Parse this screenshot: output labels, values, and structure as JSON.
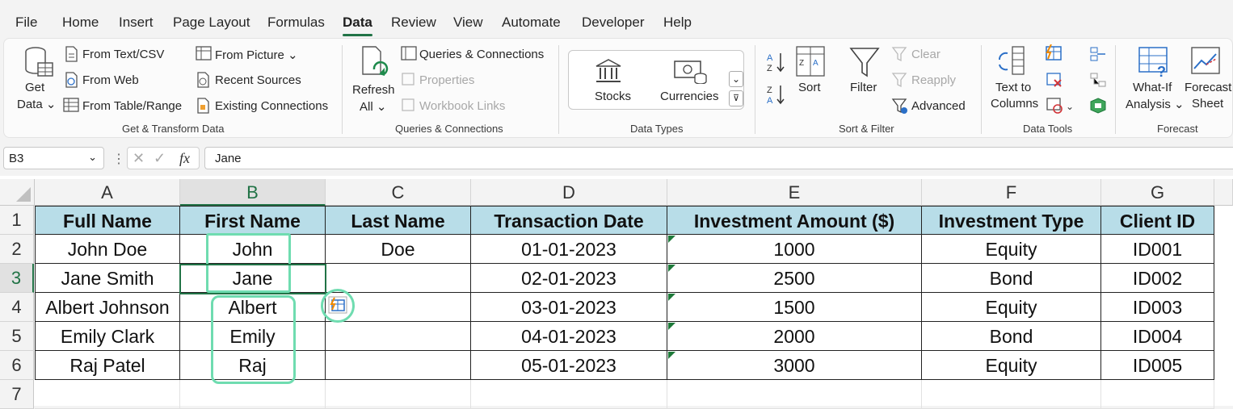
{
  "tabs": [
    "File",
    "Home",
    "Insert",
    "Page Layout",
    "Formulas",
    "Data",
    "Review",
    "View",
    "Automate",
    "Developer",
    "Help"
  ],
  "ribbon": {
    "get_data": "Get\nData",
    "get_data_line1": "Get",
    "get_data_line2": "Data",
    "from_text_csv": "From Text/CSV",
    "from_web": "From Web",
    "from_table_range": "From Table/Range",
    "from_picture": "From Picture",
    "recent_sources": "Recent Sources",
    "existing_connections": "Existing Connections",
    "group_get_transform": "Get & Transform Data",
    "refresh_line1": "Refresh",
    "refresh_line2": "All",
    "queries_connections_btn": "Queries & Connections",
    "properties": "Properties",
    "workbook_links": "Workbook Links",
    "group_queries": "Queries & Connections",
    "stocks": "Stocks",
    "currencies": "Currencies",
    "group_data_types": "Data Types",
    "sort": "Sort",
    "filter": "Filter",
    "clear": "Clear",
    "reapply": "Reapply",
    "advanced": "Advanced",
    "group_sort_filter": "Sort & Filter",
    "text_to_columns_line1": "Text to",
    "text_to_columns_line2": "Columns",
    "group_data_tools": "Data Tools",
    "what_if_line1": "What-If",
    "what_if_line2": "Analysis",
    "forecast_line1": "Forecast",
    "forecast_line2": "Sheet",
    "group_forecast": "Forecast"
  },
  "formula_bar": {
    "name_box": "B3",
    "fx": "fx",
    "formula": "Jane"
  },
  "columns": [
    "A",
    "B",
    "C",
    "D",
    "E",
    "F",
    "G"
  ],
  "rows": [
    "1",
    "2",
    "3",
    "4",
    "5",
    "6",
    "7"
  ],
  "headers": [
    "Full Name",
    "First Name",
    "Last Name",
    "Transaction Date",
    "Investment Amount ($)",
    "Investment Type",
    "Client ID"
  ],
  "data": [
    [
      "John Doe",
      "John",
      "Doe",
      "01-01-2023",
      "1000",
      "Equity",
      "ID001"
    ],
    [
      "Jane Smith",
      "Jane",
      "",
      "02-01-2023",
      "2500",
      "Bond",
      "ID002"
    ],
    [
      "Albert Johnson",
      "Albert",
      "",
      "03-01-2023",
      "1500",
      "Equity",
      "ID003"
    ],
    [
      "Emily Clark",
      "Emily",
      "",
      "04-01-2023",
      "2000",
      "Bond",
      "ID004"
    ],
    [
      "Raj Patel",
      "Raj",
      "",
      "05-01-2023",
      "3000",
      "Equity",
      "ID005"
    ]
  ],
  "colors": {
    "accent": "#217346",
    "header_fill": "#b8dde8",
    "highlight": "#6fdcb0"
  },
  "icons": [
    "get-data-icon",
    "text-csv-icon",
    "web-icon",
    "table-icon",
    "picture-icon",
    "recent-icon",
    "connections-icon",
    "refresh-icon",
    "stocks-icon",
    "currencies-icon",
    "sort-az-icon",
    "sort-za-icon",
    "filter-icon",
    "flash-fill-icon"
  ]
}
